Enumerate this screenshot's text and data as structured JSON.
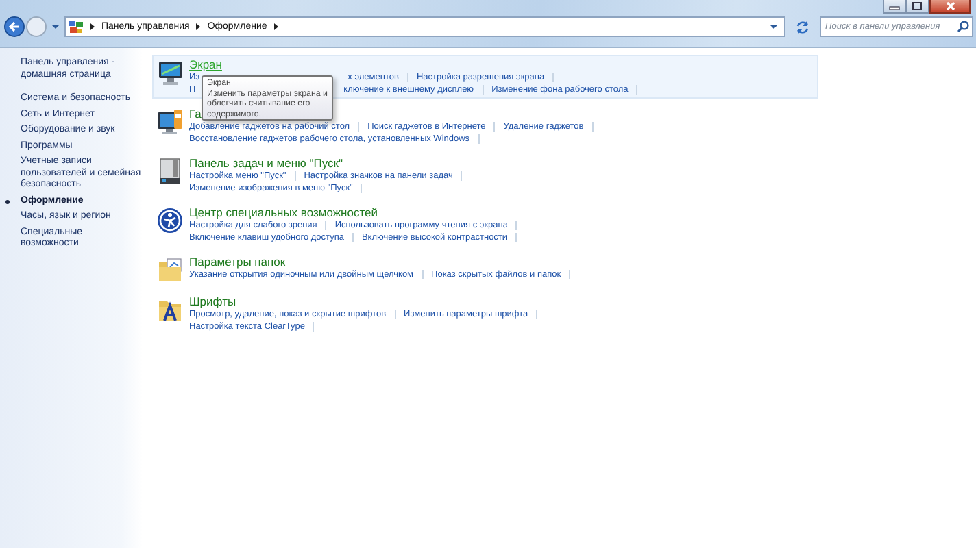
{
  "window": {
    "controls": [
      {
        "kind": "minimize"
      },
      {
        "kind": "maximize"
      },
      {
        "kind": "close"
      }
    ]
  },
  "address": {
    "crumbs": [
      "Панель управления",
      "Оформление"
    ],
    "search_placeholder": "Поиск в панели управления"
  },
  "sidebar": {
    "items": [
      {
        "label": "Панель управления - домашняя страница",
        "selected": false,
        "kind": "home"
      },
      {
        "label": "Система и безопасность",
        "selected": false,
        "kind": "link"
      },
      {
        "label": "Сеть и Интернет",
        "selected": false,
        "kind": "link"
      },
      {
        "label": "Оборудование и звук",
        "selected": false,
        "kind": "link"
      },
      {
        "label": "Программы",
        "selected": false,
        "kind": "link"
      },
      {
        "label": "Учетные записи пользователей и семейная безопасность",
        "selected": false,
        "kind": "link"
      },
      {
        "label": "Оформление",
        "selected": true,
        "kind": "link"
      },
      {
        "label": "Часы, язык и регион",
        "selected": false,
        "kind": "link"
      },
      {
        "label": "Специальные возможности",
        "selected": false,
        "kind": "link"
      }
    ]
  },
  "categories": [
    {
      "kind": "monitor",
      "title": "Экран",
      "hovered": true,
      "rows": [
        [
          {
            "kind": "fragment",
            "text": "Из"
          },
          {
            "kind": "link",
            "text": "х элементов"
          },
          {
            "kind": "link",
            "text": "Настройка разрешения экрана"
          }
        ],
        [
          {
            "kind": "fragment",
            "text": "П"
          },
          {
            "kind": "link",
            "text": "ключение к внешнему дисплею"
          },
          {
            "kind": "link",
            "text": "Изменение фона рабочего стола"
          }
        ]
      ]
    },
    {
      "kind": "gadgets",
      "title": "Га",
      "hovered": false,
      "rows": [
        [
          {
            "kind": "link",
            "text": "Добавление гаджетов на рабочий стол"
          },
          {
            "kind": "link",
            "text": "Поиск гаджетов в Интернете"
          },
          {
            "kind": "link",
            "text": "Удаление гаджетов"
          }
        ],
        [
          {
            "kind": "link",
            "text": "Восстановление гаджетов рабочего стола, установленных Windows"
          }
        ]
      ]
    },
    {
      "kind": "taskbar",
      "title": "Панель задач и меню \"Пуск\"",
      "hovered": false,
      "rows": [
        [
          {
            "kind": "link",
            "text": "Настройка меню \"Пуск\""
          },
          {
            "kind": "link",
            "text": "Настройка значков на панели задач"
          }
        ],
        [
          {
            "kind": "link",
            "text": "Изменение изображения в меню \"Пуск\""
          }
        ]
      ]
    },
    {
      "kind": "access",
      "title": "Центр специальных возможностей",
      "hovered": false,
      "rows": [
        [
          {
            "kind": "link",
            "text": "Настройка для слабого зрения"
          },
          {
            "kind": "link",
            "text": "Использовать программу чтения с экрана"
          }
        ],
        [
          {
            "kind": "link",
            "text": "Включение клавиш удобного доступа"
          },
          {
            "kind": "link",
            "text": "Включение высокой контрастности"
          }
        ]
      ]
    },
    {
      "kind": "folder",
      "title": "Параметры папок",
      "hovered": false,
      "rows": [
        [
          {
            "kind": "link",
            "text": "Указание открытия одиночным или двойным щелчком"
          },
          {
            "kind": "link",
            "text": "Показ скрытых файлов и папок"
          }
        ]
      ]
    },
    {
      "kind": "fonts",
      "title": "Шрифты",
      "hovered": false,
      "rows": [
        [
          {
            "kind": "link",
            "text": "Просмотр, удаление, показ и скрытие шрифтов"
          },
          {
            "kind": "link",
            "text": "Изменить параметры шрифта"
          }
        ],
        [
          {
            "kind": "link",
            "text": "Настройка текста ClearType"
          }
        ]
      ]
    }
  ],
  "tooltip": {
    "title": "Экран",
    "text": "Изменить параметры экрана и облегчить считывание его содержимого."
  }
}
